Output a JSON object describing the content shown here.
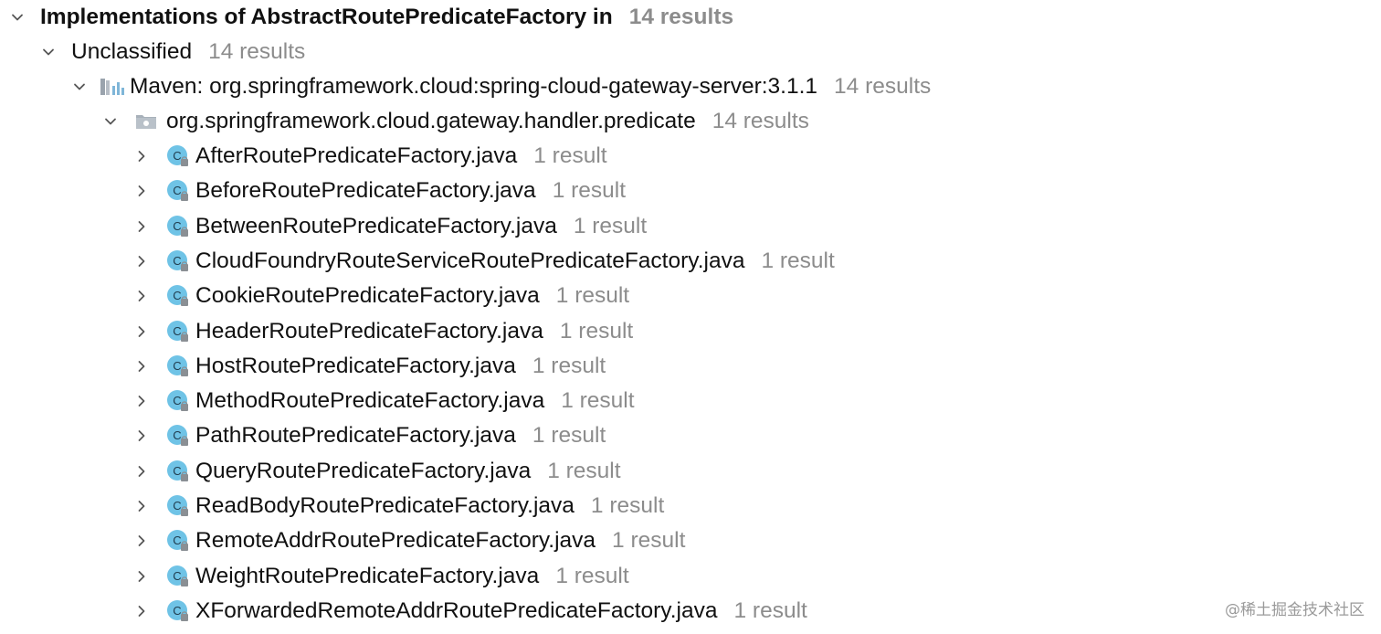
{
  "header": {
    "title": "Implementations of AbstractRoutePredicateFactory in",
    "count": "14 results"
  },
  "group": {
    "label": "Unclassified",
    "count": "14 results"
  },
  "module": {
    "label": "Maven: org.springframework.cloud:spring-cloud-gateway-server:3.1.1",
    "count": "14 results",
    "icon": "library-icon"
  },
  "package": {
    "label": "org.springframework.cloud.gateway.handler.predicate",
    "count": "14 results",
    "icon": "package-icon"
  },
  "files": [
    {
      "label": "AfterRoutePredicateFactory.java",
      "count": "1 result"
    },
    {
      "label": "BeforeRoutePredicateFactory.java",
      "count": "1 result"
    },
    {
      "label": "BetweenRoutePredicateFactory.java",
      "count": "1 result"
    },
    {
      "label": "CloudFoundryRouteServiceRoutePredicateFactory.java",
      "count": "1 result"
    },
    {
      "label": "CookieRoutePredicateFactory.java",
      "count": "1 result"
    },
    {
      "label": "HeaderRoutePredicateFactory.java",
      "count": "1 result"
    },
    {
      "label": "HostRoutePredicateFactory.java",
      "count": "1 result"
    },
    {
      "label": "MethodRoutePredicateFactory.java",
      "count": "1 result"
    },
    {
      "label": "PathRoutePredicateFactory.java",
      "count": "1 result"
    },
    {
      "label": "QueryRoutePredicateFactory.java",
      "count": "1 result"
    },
    {
      "label": "ReadBodyRoutePredicateFactory.java",
      "count": "1 result"
    },
    {
      "label": "RemoteAddrRoutePredicateFactory.java",
      "count": "1 result"
    },
    {
      "label": "WeightRoutePredicateFactory.java",
      "count": "1 result"
    },
    {
      "label": "XForwardedRemoteAddrRoutePredicateFactory.java",
      "count": "1 result"
    }
  ],
  "file_icon": "java-class-icon",
  "watermark": "@稀土掘金技术社区",
  "colors": {
    "text": "#111111",
    "count": "#8c8c8c",
    "class_icon": "#6fc3e6",
    "chevron": "#555555"
  }
}
